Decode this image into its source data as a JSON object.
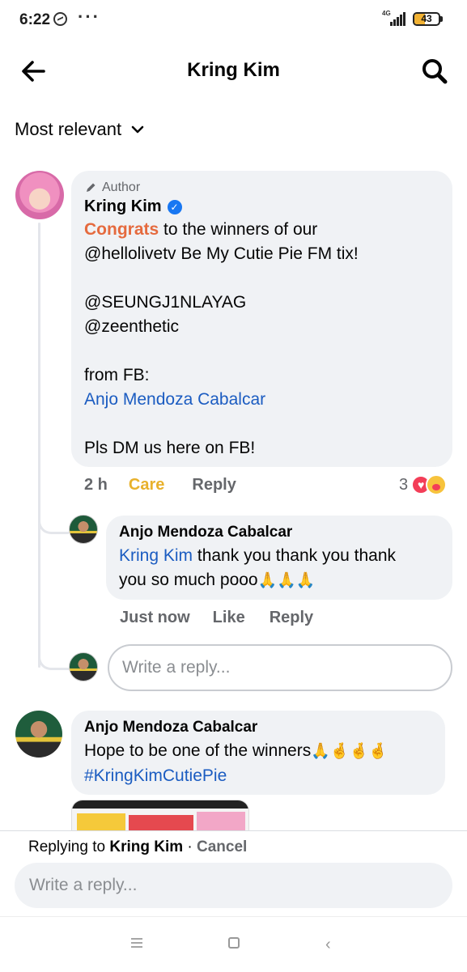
{
  "status_bar": {
    "time": "6:22",
    "more": "···",
    "network": "4G",
    "battery": "43",
    "battery_level": 0.43
  },
  "header": {
    "title": "Kring Kim",
    "back_icon": "arrow-left-icon",
    "search_icon": "search-icon"
  },
  "sort": {
    "label": "Most relevant",
    "icon": "chevron-down-icon"
  },
  "main_comment": {
    "badge": "Author",
    "author": "Kring Kim",
    "verified": true,
    "highlight": "Congrats",
    "line1": " to the winners of our",
    "line2": "@hellolivetv Be My Cutie Pie FM tix!",
    "mention1": "@SEUNGJ1NLAYAG",
    "mention2": "@zeenthetic",
    "from_label": "from FB:",
    "from_name": "Anjo Mendoza Cabalcar",
    "closing": "Pls DM us here on FB!",
    "time": "2 h",
    "reaction_label": "Care",
    "reply_label": "Reply",
    "reaction_count": "3"
  },
  "reply_comment": {
    "author": "Anjo Mendoza Cabalcar",
    "mention": "Kring Kim",
    "text_line1": " thank you thank you thank",
    "text_line2": "you so much pooo",
    "emojis": "🙏🙏🙏",
    "time": "Just now",
    "like_label": "Like",
    "reply_label": "Reply"
  },
  "thread_reply_input": {
    "placeholder": "Write a reply..."
  },
  "second_comment": {
    "author": "Anjo Mendoza Cabalcar",
    "text": "Hope to be one of the winners",
    "emojis": "🙏🤞🤞🤞",
    "hashtag": "#KringKimCutiePie"
  },
  "reply_bar": {
    "prefix": "Replying to ",
    "target": "Kring Kim",
    "separator": " · ",
    "cancel": "Cancel",
    "placeholder": "Write a reply..."
  },
  "nav": {
    "menu_icon": "menu-icon",
    "home_icon": "home-icon",
    "back_icon": "back-icon"
  },
  "colors": {
    "link": "#1b5cc1",
    "care": "#e8b12c",
    "congrats": "#e56a3e",
    "bubble": "#f0f2f5",
    "verified": "#1877f2"
  }
}
